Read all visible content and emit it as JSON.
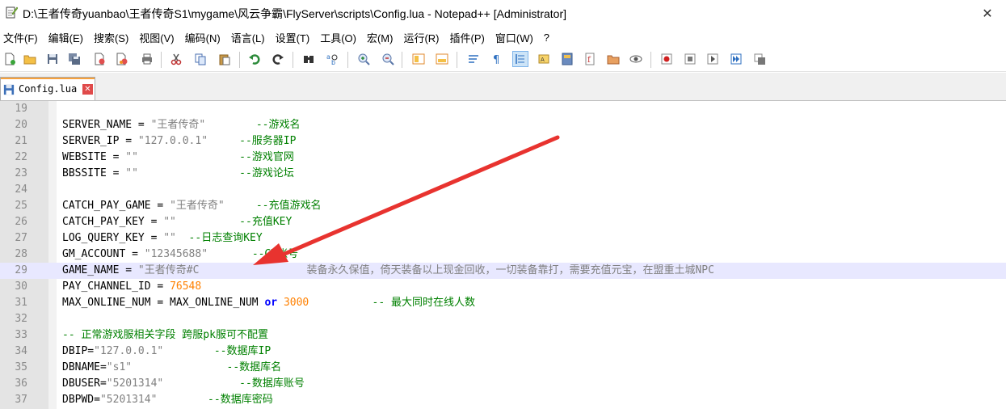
{
  "window": {
    "title": "D:\\王者传奇yuanbao\\王者传奇S1\\mygame\\风云争霸\\FlyServer\\scripts\\Config.lua - Notepad++ [Administrator]",
    "close_glyph": "✕"
  },
  "menu": [
    "文件(F)",
    "编辑(E)",
    "搜索(S)",
    "视图(V)",
    "编码(N)",
    "语言(L)",
    "设置(T)",
    "工具(O)",
    "宏(M)",
    "运行(R)",
    "插件(P)",
    "窗口(W)",
    "?"
  ],
  "tab": {
    "label": "Config.lua",
    "close_glyph": "✕"
  },
  "editor": {
    "lines": [
      {
        "num": "19",
        "segments": []
      },
      {
        "num": "20",
        "segments": [
          [
            "SERVER_NAME = ",
            "plain"
          ],
          [
            "\"王者传奇\"",
            "str"
          ],
          [
            "        ",
            "plain"
          ],
          [
            "--游戏名",
            "cmt"
          ]
        ]
      },
      {
        "num": "21",
        "segments": [
          [
            "SERVER_IP = ",
            "plain"
          ],
          [
            "\"127.0.0.1\"",
            "str"
          ],
          [
            "     ",
            "plain"
          ],
          [
            "--服务器IP",
            "cmt"
          ]
        ]
      },
      {
        "num": "22",
        "segments": [
          [
            "WEBSITE = ",
            "plain"
          ],
          [
            "\"\"",
            "str"
          ],
          [
            "                ",
            "plain"
          ],
          [
            "--游戏官网",
            "cmt"
          ]
        ]
      },
      {
        "num": "23",
        "segments": [
          [
            "BBSSITE = ",
            "plain"
          ],
          [
            "\"\"",
            "str"
          ],
          [
            "                ",
            "plain"
          ],
          [
            "--游戏论坛",
            "cmt"
          ]
        ]
      },
      {
        "num": "24",
        "segments": []
      },
      {
        "num": "25",
        "segments": [
          [
            "CATCH_PAY_GAME = ",
            "plain"
          ],
          [
            "\"王者传奇\"",
            "str"
          ],
          [
            "     ",
            "plain"
          ],
          [
            "--充值游戏名",
            "cmt"
          ]
        ]
      },
      {
        "num": "26",
        "segments": [
          [
            "CATCH_PAY_KEY = ",
            "plain"
          ],
          [
            "\"\"",
            "str"
          ],
          [
            "          ",
            "plain"
          ],
          [
            "--充值KEY",
            "cmt"
          ]
        ]
      },
      {
        "num": "27",
        "segments": [
          [
            "LOG_QUERY_KEY = ",
            "plain"
          ],
          [
            "\"\"",
            "str"
          ],
          [
            "  ",
            "plain"
          ],
          [
            "--日志查询KEY",
            "cmt"
          ]
        ]
      },
      {
        "num": "28",
        "segments": [
          [
            "GM_ACCOUNT = ",
            "plain"
          ],
          [
            "\"12345688\"",
            "str"
          ],
          [
            "       ",
            "plain"
          ],
          [
            "--GM账号",
            "cmt"
          ]
        ]
      },
      {
        "num": "29",
        "segments": [
          [
            "GAME_NAME = ",
            "plain"
          ],
          [
            "\"王者传奇#C",
            "str"
          ],
          [
            "                 ",
            "plain"
          ],
          [
            "装备永久保值，倚天装备以上现金回收，一切装备靠打，需要充值元宝，在盟重土城NPC",
            "str"
          ]
        ]
      },
      {
        "num": "30",
        "segments": [
          [
            "PAY_CHANNEL_ID = ",
            "plain"
          ],
          [
            "76548",
            "num"
          ]
        ]
      },
      {
        "num": "31",
        "segments": [
          [
            "MAX_ONLINE_NUM = MAX_ONLINE_NUM ",
            "plain"
          ],
          [
            "or",
            "kw"
          ],
          [
            " ",
            "plain"
          ],
          [
            "3000",
            "num"
          ],
          [
            "          ",
            "plain"
          ],
          [
            "-- 最大同时在线人数",
            "cmt"
          ]
        ]
      },
      {
        "num": "32",
        "segments": []
      },
      {
        "num": "33",
        "segments": [
          [
            "-- 正常游戏服相关字段 跨服pk服可不配置",
            "cmt"
          ]
        ]
      },
      {
        "num": "34",
        "segments": [
          [
            "DBIP=",
            "plain"
          ],
          [
            "\"127.0.0.1\"",
            "str"
          ],
          [
            "        ",
            "plain"
          ],
          [
            "--数据库IP",
            "cmt"
          ]
        ]
      },
      {
        "num": "35",
        "segments": [
          [
            "DBNAME=",
            "plain"
          ],
          [
            "\"s1\"",
            "str"
          ],
          [
            "               ",
            "plain"
          ],
          [
            "--数据库名",
            "cmt"
          ]
        ]
      },
      {
        "num": "36",
        "segments": [
          [
            "DBUSER=",
            "plain"
          ],
          [
            "\"5201314\"",
            "str"
          ],
          [
            "            ",
            "plain"
          ],
          [
            "--数据库账号",
            "cmt"
          ]
        ]
      },
      {
        "num": "37",
        "segments": [
          [
            "DBPWD=",
            "plain"
          ],
          [
            "\"5201314\"",
            "str"
          ],
          [
            "        ",
            "plain"
          ],
          [
            "--数据库密码",
            "cmt"
          ]
        ]
      }
    ],
    "current_line": "29"
  },
  "colors": {
    "string": "#808080",
    "number": "#ff8000",
    "keyword": "#0000ff",
    "comment": "#008000",
    "current_line": "#e8e8ff",
    "annotation_arrow": "#e8332f"
  },
  "toolbar_icons": [
    "new-file-icon",
    "open-file-icon",
    "save-icon",
    "save-all-icon",
    "close-icon",
    "close-all-icon",
    "print-icon",
    "cut-icon",
    "copy-icon",
    "paste-icon",
    "undo-icon",
    "redo-icon",
    "find-icon",
    "replace-icon",
    "zoom-in-icon",
    "zoom-out-icon",
    "sync-vertical-icon",
    "sync-horizontal-icon",
    "word-wrap-icon",
    "show-all-chars-icon",
    "indent-guide-icon",
    "udl-icon",
    "doc-map-icon",
    "function-list-icon",
    "folder-workspace-icon",
    "monitor-icon",
    "record-macro-icon",
    "stop-record-icon",
    "play-macro-icon",
    "run-macro-multiple-icon",
    "save-macro-icon"
  ]
}
